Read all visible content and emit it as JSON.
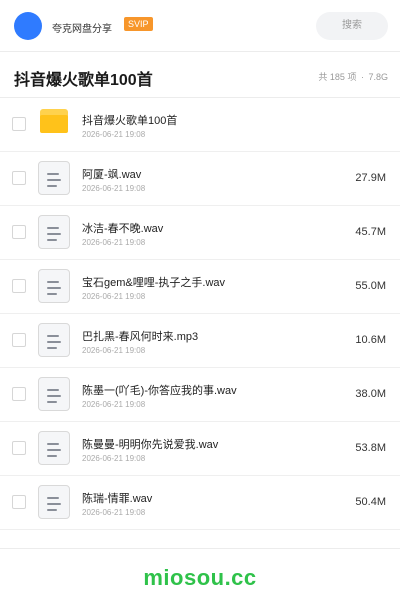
{
  "header": {
    "brand": "夸克网盘分享",
    "badge": "SVIP",
    "search_label": "搜索"
  },
  "title_row": {
    "title": "抖音爆火歌单100首",
    "count": "共 185 项",
    "separator": "·",
    "total_size": "7.8G"
  },
  "files": [
    {
      "name": "抖音爆火歌单100首",
      "date": "2026-06-21 19:08",
      "size": "",
      "type": "folder"
    },
    {
      "name": "阿厦-飒.wav",
      "date": "2026-06-21 19:08",
      "size": "27.9M",
      "type": "file"
    },
    {
      "name": "冰洁-春不晚.wav",
      "date": "2026-06-21 19:08",
      "size": "45.7M",
      "type": "file"
    },
    {
      "name": "宝石gem&哩哩-执子之手.wav",
      "date": "2026-06-21 19:08",
      "size": "55.0M",
      "type": "file"
    },
    {
      "name": "巴扎黑-春风何时来.mp3",
      "date": "2026-06-21 19:08",
      "size": "10.6M",
      "type": "file"
    },
    {
      "name": "陈墨一(吖毛)-你答应我的事.wav",
      "date": "2026-06-21 19:08",
      "size": "38.0M",
      "type": "file"
    },
    {
      "name": "陈曼曼-明明你先说爱我.wav",
      "date": "2026-06-21 19:08",
      "size": "53.8M",
      "type": "file"
    },
    {
      "name": "陈瑞-情罪.wav",
      "date": "2026-06-21 19:08",
      "size": "50.4M",
      "type": "file"
    }
  ],
  "footer": {
    "watermark": "miosou.cc"
  }
}
